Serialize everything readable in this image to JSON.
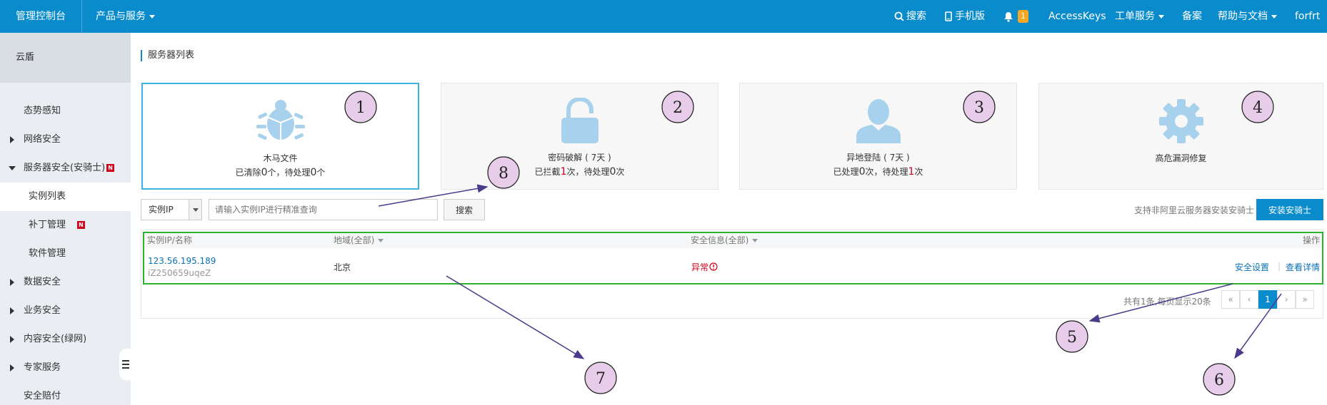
{
  "topbar": {
    "brand": "管理控制台",
    "products": "产品与服务",
    "search": "搜索",
    "mobile": "手机版",
    "notifications": "1",
    "accesskeys": "AccessKeys",
    "tickets": "工单服务",
    "beian": "备案",
    "help": "帮助与文档",
    "user": "forfrt"
  },
  "sidebar": {
    "title": "云盾",
    "items": [
      {
        "label": "态势感知"
      },
      {
        "label": "网络安全"
      },
      {
        "label": "服务器安全(安骑士)",
        "badge": "N"
      },
      {
        "label": "实例列表"
      },
      {
        "label": "补丁管理",
        "badge": "N"
      },
      {
        "label": "软件管理"
      },
      {
        "label": "数据安全"
      },
      {
        "label": "业务安全"
      },
      {
        "label": "内容安全(绿网)"
      },
      {
        "label": "专家服务"
      },
      {
        "label": "安全赔付"
      }
    ]
  },
  "main": {
    "title": "服务器列表",
    "cards": [
      {
        "title": "木马文件",
        "p1": "已清除",
        "v1": "0",
        "p2": "个，待处理",
        "v2": "0",
        "p3": "个",
        "icon": "bug-icon"
      },
      {
        "title": "密码破解 ( 7天 )",
        "p1": "已拦截",
        "v1": "1",
        "p2": "次，待处理",
        "v2": "0",
        "p3": "次",
        "icon": "lock-icon"
      },
      {
        "title": "异地登陆 ( 7天 )",
        "p1": "已处理",
        "v1": "0",
        "p2": "次，待处理",
        "v2": "1",
        "p3": "次",
        "icon": "user-icon"
      },
      {
        "title": "高危漏洞修复",
        "icon": "gear-icon"
      }
    ],
    "filter": {
      "select": "实例IP",
      "placeholder": "请输入实例IP进行精准查询",
      "search_btn": "搜索",
      "support_text": "支持非阿里云服务器安装安骑士",
      "install_btn": "安装安骑士"
    },
    "table": {
      "headers": {
        "name": "实例IP/名称",
        "region": "地域(全部)",
        "security": "安全信息(全部)",
        "ops": "操作"
      },
      "rows": [
        {
          "ip": "123.56.195.189",
          "id": "iZ250659uqeZ",
          "region": "北京",
          "status": "异常",
          "op1": "安全设置",
          "op2": "查看详情"
        }
      ]
    },
    "pagination": {
      "info": "共有1条,每页显示20条",
      "first": "«",
      "prev": "‹",
      "current": "1",
      "next": "›",
      "last": "»"
    }
  },
  "annotations": [
    "1",
    "2",
    "3",
    "4",
    "5",
    "6",
    "7",
    "8"
  ],
  "colors": {
    "topbar": "#0a8ccc",
    "accent": "#0a8ccc",
    "danger": "#d0021b",
    "highlight_border": "#2bb32b",
    "annotation_fill": "#e7cdea",
    "arrow": "#4b3a8c"
  }
}
